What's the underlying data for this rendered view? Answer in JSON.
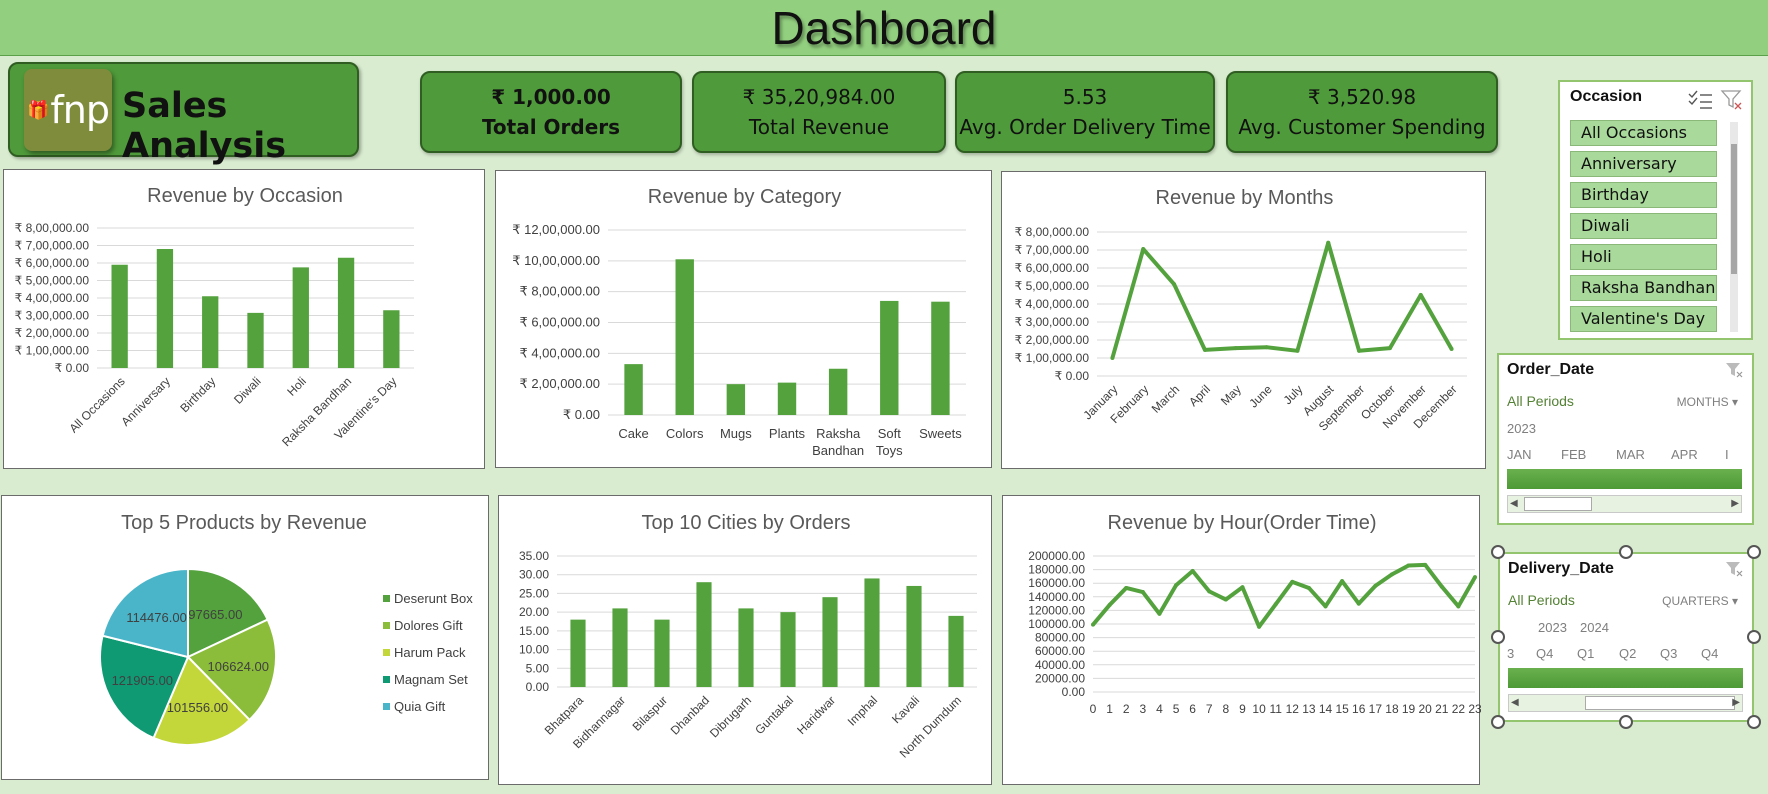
{
  "dashboard_title": "Dashboard",
  "brand": {
    "logo_text": "fnp",
    "title": "Sales Analysis"
  },
  "kpis": [
    {
      "value": "₹ 1,000.00",
      "label": "Total Orders"
    },
    {
      "value": "₹ 35,20,984.00",
      "label": "Total Revenue"
    },
    {
      "value": "5.53",
      "label": "Avg. Order Delivery Time"
    },
    {
      "value": "₹ 3,520.98",
      "label": "Avg. Customer Spending"
    }
  ],
  "colors": {
    "bar": "#54a23d",
    "header": "#92d07f",
    "kpi": "#4f9a3a",
    "background": "#d9ecd0"
  },
  "slicer": {
    "title": "Occasion",
    "items": [
      "All Occasions",
      "Anniversary",
      "Birthday",
      "Diwali",
      "Holi",
      "Raksha Bandhan",
      "Valentine's Day"
    ]
  },
  "order_timeline": {
    "title": "Order_Date",
    "all_periods": "All Periods",
    "level": "MONTHS ▾",
    "years": [
      "2023"
    ],
    "periods": [
      "JAN",
      "FEB",
      "MAR",
      "APR",
      "I"
    ]
  },
  "delivery_timeline": {
    "title": "Delivery_Date",
    "all_periods": "All Periods",
    "level": "QUARTERS ▾",
    "years": [
      "2023",
      "2024"
    ],
    "periods": [
      "3",
      "Q4",
      "Q1",
      "Q2",
      "Q3",
      "Q4"
    ]
  },
  "chart_data": [
    {
      "id": "occasion",
      "type": "bar",
      "title": "Revenue by Occasion",
      "categories": [
        "All Occasions",
        "Anniversary",
        "Birthday",
        "Diwali",
        "Holi",
        "Raksha Bandhan",
        "Valentine's Day"
      ],
      "values": [
        590000,
        680000,
        410000,
        315000,
        575000,
        630000,
        330000
      ],
      "yticks": [
        "₹ 0.00",
        "₹ 1,00,000.00",
        "₹ 2,00,000.00",
        "₹ 3,00,000.00",
        "₹ 4,00,000.00",
        "₹ 5,00,000.00",
        "₹ 6,00,000.00",
        "₹ 7,00,000.00",
        "₹ 8,00,000.00"
      ],
      "ylim": [
        0,
        800000
      ],
      "grid": true
    },
    {
      "id": "category",
      "type": "bar",
      "title": "Revenue by Category",
      "categories": [
        "Cake",
        "Colors",
        "Mugs",
        "Plants",
        "Raksha Bandhan",
        "Soft Toys",
        "Sweets"
      ],
      "values": [
        330000,
        1010000,
        200000,
        210000,
        300000,
        740000,
        735000
      ],
      "yticks": [
        "₹ 0.00",
        "₹ 2,00,000.00",
        "₹ 4,00,000.00",
        "₹ 6,00,000.00",
        "₹ 8,00,000.00",
        "₹ 10,00,000.00",
        "₹ 12,00,000.00"
      ],
      "ylim": [
        0,
        1200000
      ],
      "grid": true
    },
    {
      "id": "months",
      "type": "line",
      "title": "Revenue by Months",
      "categories": [
        "January",
        "February",
        "March",
        "April",
        "May",
        "June",
        "July",
        "August",
        "September",
        "October",
        "November",
        "December"
      ],
      "values": [
        100000,
        705000,
        510000,
        145000,
        155000,
        160000,
        140000,
        740000,
        140000,
        155000,
        450000,
        150000
      ],
      "yticks": [
        "₹ 0.00",
        "₹ 1,00,000.00",
        "₹ 2,00,000.00",
        "₹ 3,00,000.00",
        "₹ 4,00,000.00",
        "₹ 5,00,000.00",
        "₹ 6,00,000.00",
        "₹ 7,00,000.00",
        "₹ 8,00,000.00"
      ],
      "ylim": [
        0,
        800000
      ],
      "grid": true
    },
    {
      "id": "products",
      "type": "pie",
      "title": "Top 5 Products by Revenue",
      "categories": [
        "Deserunt Box",
        "Dolores Gift",
        "Harum Pack",
        "Magnam Set",
        "Quia Gift"
      ],
      "values": [
        97665.0,
        106624.0,
        101556.0,
        121905.0,
        114476.0
      ],
      "labels": [
        "97665.00",
        "106624.00",
        "101556.00",
        "121905.00",
        "114476.00"
      ],
      "colors": [
        "#54a23d",
        "#8bbd3a",
        "#c3d63a",
        "#0f9a74",
        "#4ab5c9"
      ],
      "legend": "right"
    },
    {
      "id": "cities",
      "type": "bar",
      "title": "Top 10 Cities by Orders",
      "categories": [
        "Bhatpara",
        "Bidhannagar",
        "Bilaspur",
        "Dhanbad",
        "Dibrugarh",
        "Guntakal",
        "Haridwar",
        "Imphal",
        "Kavali",
        "North Dumdum"
      ],
      "values": [
        18,
        21,
        18,
        28,
        21,
        20,
        24,
        29,
        27,
        19
      ],
      "yticks": [
        "0.00",
        "5.00",
        "10.00",
        "15.00",
        "20.00",
        "25.00",
        "30.00",
        "35.00"
      ],
      "ylim": [
        0,
        35
      ],
      "grid": true
    },
    {
      "id": "hours",
      "type": "line",
      "title": "Revenue by Hour(Order Time)",
      "categories": [
        "0",
        "1",
        "2",
        "3",
        "4",
        "5",
        "6",
        "7",
        "8",
        "9",
        "10",
        "11",
        "12",
        "13",
        "14",
        "15",
        "16",
        "17",
        "18",
        "19",
        "20",
        "21",
        "22",
        "23"
      ],
      "values": [
        99000,
        128000,
        153000,
        147000,
        115000,
        157000,
        178000,
        148000,
        136000,
        154000,
        96000,
        129000,
        162000,
        153000,
        126000,
        163000,
        130000,
        156000,
        173000,
        186000,
        187000,
        155000,
        126000,
        169000
      ],
      "yticks": [
        "0.00",
        "20000.00",
        "40000.00",
        "60000.00",
        "80000.00",
        "100000.00",
        "120000.00",
        "140000.00",
        "160000.00",
        "180000.00",
        "200000.00"
      ],
      "ylim": [
        0,
        200000
      ],
      "grid": true
    }
  ]
}
